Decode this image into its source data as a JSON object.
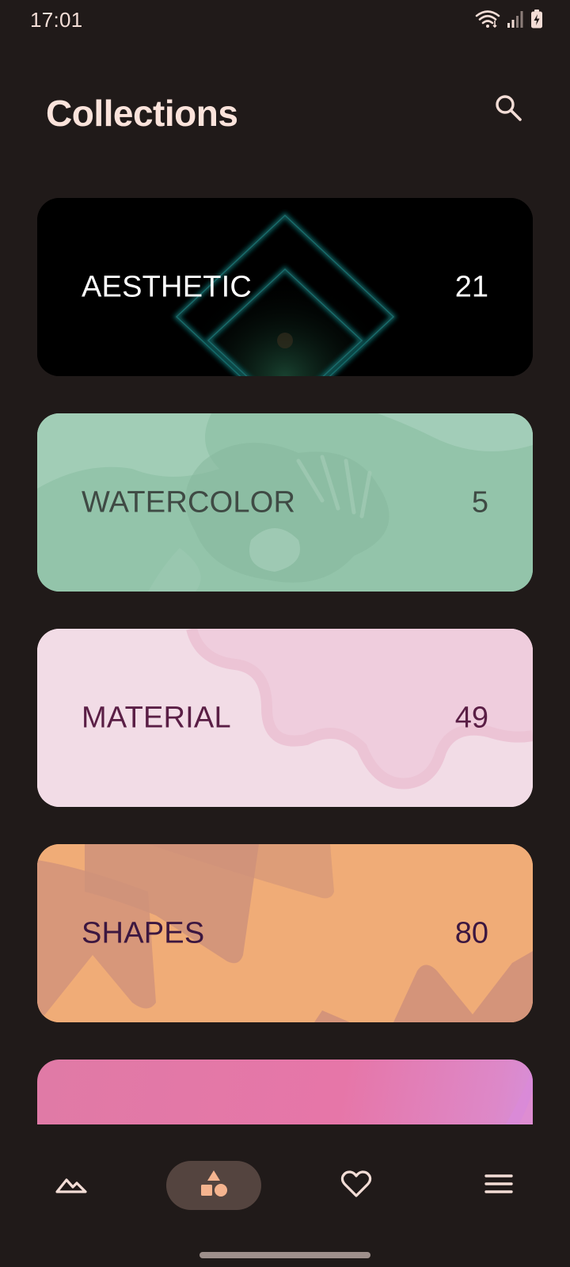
{
  "status_bar": {
    "time": "17:01",
    "icons": [
      "wifi-icon",
      "signal-icon",
      "battery-charging-icon"
    ]
  },
  "header": {
    "title": "Collections",
    "search_icon": "search-icon"
  },
  "collections": [
    {
      "name": "AESTHETIC",
      "count": "21",
      "style": "dark-diamond"
    },
    {
      "name": "WATERCOLOR",
      "count": "5",
      "style": "mint-watercolor"
    },
    {
      "name": "MATERIAL",
      "count": "49",
      "style": "pink-wave"
    },
    {
      "name": "SHAPES",
      "count": "80",
      "style": "orange-shapes"
    },
    {
      "name": "",
      "count": "",
      "style": "pink-gradient-partial"
    }
  ],
  "bottom_nav": {
    "items": [
      {
        "icon": "mountain-icon",
        "active": false
      },
      {
        "icon": "shapes-icon",
        "active": true
      },
      {
        "icon": "heart-icon",
        "active": false
      },
      {
        "icon": "menu-icon",
        "active": false
      }
    ]
  },
  "colors": {
    "background": "#201a19",
    "on_background": "#f3ddd6",
    "nav_active": "#54443f",
    "accent": "#f5b48f"
  }
}
